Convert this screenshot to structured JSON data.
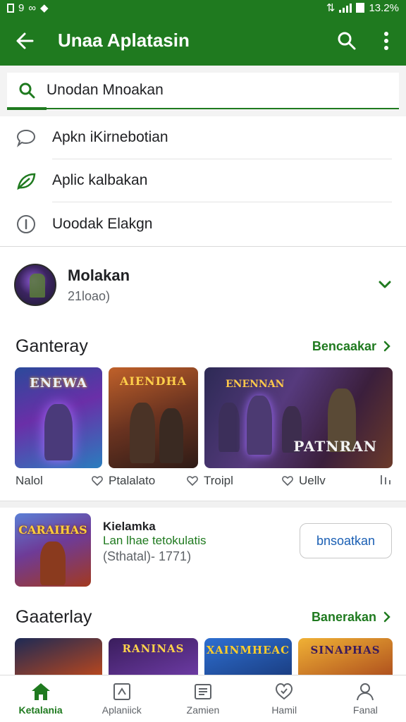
{
  "status_bar": {
    "left_text": "9",
    "right_text": "13.2%"
  },
  "app_bar": {
    "title": "Unaa Aplatasin"
  },
  "search": {
    "value": "Unodan Mnoakan"
  },
  "suggestions": [
    {
      "label": "Apkn iKirnebotian",
      "icon": "chat-icon"
    },
    {
      "label": "Aplic kalbakan",
      "icon": "leaf-icon"
    },
    {
      "label": "Uoodak Elakgn",
      "icon": "info-icon"
    }
  ],
  "account": {
    "name": "Molakan",
    "subtitle": "21loao)"
  },
  "section1": {
    "title": "Ganteray",
    "link": "Bencaakar"
  },
  "games_row1": [
    {
      "title": "ENEWA",
      "label": "Nalol"
    },
    {
      "title": "AIENDHA",
      "label": "Ptalalato"
    },
    {
      "title": "PATNRAN",
      "label": "Troipl",
      "top_text": "ENENNAN"
    }
  ],
  "games_row1_extra_label": "Uellv",
  "featured": {
    "icon_title": "CARAIHAS",
    "title": "Kielamka",
    "subtitle": "Lan lhae tetokulatis",
    "meta": "(Sthatal)- 1771)",
    "button": "bnsoatkan"
  },
  "section2": {
    "title": "Gaaterlay",
    "link": "Banerakan"
  },
  "games_row2": [
    {
      "title": ""
    },
    {
      "title": "RANINAS"
    },
    {
      "title": "XAINMHEAC"
    },
    {
      "title": "SINAPHAS"
    }
  ],
  "bottom_nav": [
    {
      "label": "Ketalania",
      "icon": "home-icon",
      "active": true
    },
    {
      "label": "Aplaniick",
      "icon": "apps-icon",
      "active": false
    },
    {
      "label": "Zamien",
      "icon": "list-icon",
      "active": false
    },
    {
      "label": "Hamil",
      "icon": "heart-icon",
      "active": false
    },
    {
      "label": "Fanal",
      "icon": "person-icon",
      "active": false
    }
  ],
  "colors": {
    "primary_green": "#1f7a1f",
    "link_blue": "#1a5fb4"
  }
}
